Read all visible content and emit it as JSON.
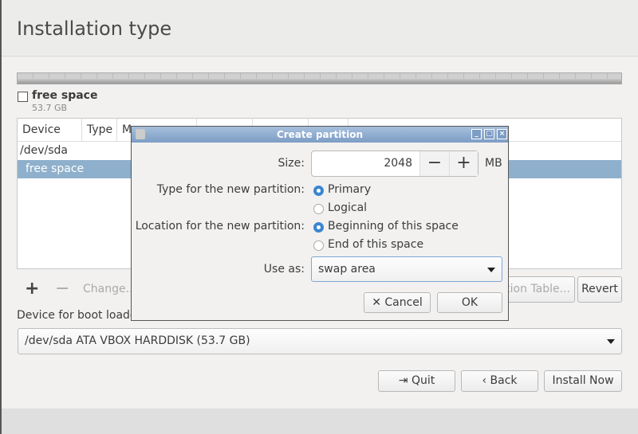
{
  "page": {
    "title": "Installation type"
  },
  "partition_bar": {
    "free_label": "free space",
    "free_size": "53.7 GB"
  },
  "table": {
    "columns": [
      "Device",
      "Type",
      "M",
      "",
      "",
      "",
      ""
    ],
    "rows": [
      {
        "device": "/dev/sda"
      },
      {
        "device": "free space",
        "selected": true
      }
    ]
  },
  "toolbar": {
    "add": "+",
    "remove": "−",
    "change": "Change...",
    "new_table": "tion Table...",
    "revert": "Revert"
  },
  "bootloader": {
    "label": "Device for boot loader installation:",
    "label_visible": "Device for boot loade",
    "value": "/dev/sda ATA VBOX HARDDISK (53.7 GB)"
  },
  "nav": {
    "quit": "Quit",
    "back": "Back",
    "install": "Install Now"
  },
  "dialog": {
    "title": "Create partition",
    "size_label": "Size:",
    "size_value": "2048",
    "size_unit": "MB",
    "type_label": "Type for the new partition:",
    "type_options": [
      "Primary",
      "Logical"
    ],
    "type_selected": "Primary",
    "location_label": "Location for the new partition:",
    "location_options": [
      "Beginning of this space",
      "End of this space"
    ],
    "location_selected": "Beginning of this space",
    "use_as_label": "Use as:",
    "use_as_value": "swap area",
    "cancel": "Cancel",
    "ok": "OK"
  },
  "colors": {
    "selection": "#8fb0cc",
    "titlebar": "#7d9dc5",
    "radio": "#3b86d0"
  }
}
